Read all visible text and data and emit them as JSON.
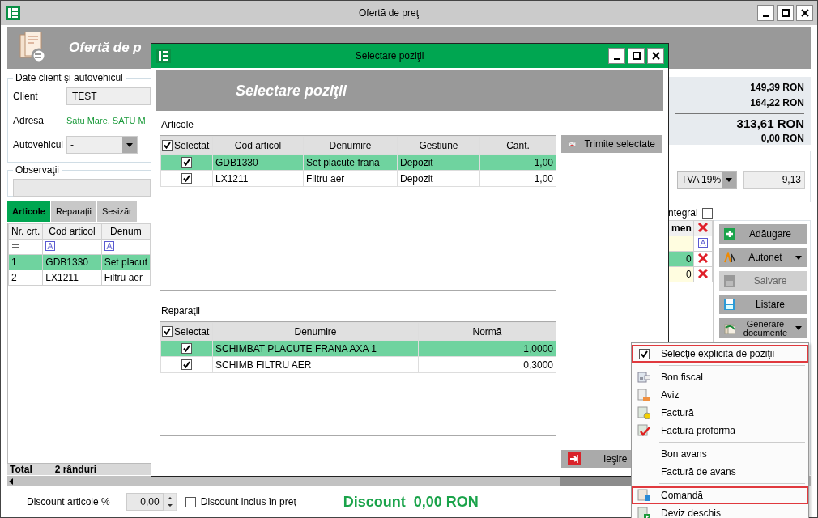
{
  "window": {
    "title": "Ofertă de preţ"
  },
  "header": {
    "title": "Ofertă de p"
  },
  "client_group": {
    "title": "Date client şi autovehicul",
    "fields": [
      {
        "label": "Client",
        "value": "TEST",
        "kind": "text"
      },
      {
        "label": "Adresă",
        "value": "Satu Mare, SATU M",
        "kind": "link"
      },
      {
        "label": "Autovehicul",
        "value": "-",
        "kind": "combo"
      }
    ]
  },
  "observations": {
    "title": "Observaţii"
  },
  "tabs": [
    {
      "label": "Articole",
      "selected": true
    },
    {
      "label": "Reparaţii",
      "selected": false
    },
    {
      "label": "Sesizăr",
      "selected": false
    }
  ],
  "grid": {
    "columns": [
      "Nr. crt.",
      "Cod articol",
      "Denum"
    ],
    "rows": [
      {
        "cells": [
          "1",
          "GDB1330",
          "Set placut"
        ],
        "value": "0",
        "selected": true
      },
      {
        "cells": [
          "2",
          "LX1211",
          "Filtru aer"
        ],
        "value": "0",
        "selected": false
      }
    ],
    "right_column": "men",
    "total_label": "Total",
    "total_count": "2 rânduri"
  },
  "totals": [
    "149,39 RON",
    "164,22 RON",
    "313,61 RON",
    "0,00 RON"
  ],
  "tva": {
    "value": "TVA 19%",
    "amount": "9,13"
  },
  "integral": {
    "label": "ntegral",
    "checked": false
  },
  "actions": [
    {
      "label": "Adăugare",
      "disabled": false,
      "dropdown": false
    },
    {
      "label": "Autonet",
      "disabled": false,
      "dropdown": true
    },
    {
      "label": "Salvare",
      "disabled": true,
      "dropdown": false
    },
    {
      "label": "Listare",
      "disabled": false,
      "dropdown": false
    },
    {
      "label": "Generare documente",
      "disabled": false,
      "dropdown": true
    }
  ],
  "discount": {
    "label": "Discount articole %",
    "value": "0,00",
    "included_label": "Discount inclus în preţ",
    "included": false,
    "summary_label": "Discount",
    "summary_value": "0,00 RON"
  },
  "dialog": {
    "title": "Selectare poziţii",
    "header": "Selectare poziţii",
    "articles": {
      "label": "Articole",
      "all_checked": true,
      "columns": [
        "Selectat",
        "Cod articol",
        "Denumire",
        "Gestiune",
        "Cant."
      ],
      "rows": [
        {
          "checked": true,
          "selected": true,
          "cells": [
            "",
            "GDB1330",
            "Set placute frana",
            "Depozit",
            "1,00"
          ]
        },
        {
          "checked": true,
          "selected": false,
          "cells": [
            "",
            "LX1211",
            "Filtru aer",
            "Depozit",
            "1,00"
          ]
        }
      ]
    },
    "send_button": "Trimite selectate",
    "repairs": {
      "label": "Reparaţii",
      "all_checked": true,
      "columns": [
        "Selectat",
        "Denumire",
        "Normă"
      ],
      "rows": [
        {
          "checked": true,
          "selected": true,
          "cells": [
            "",
            "SCHIMBAT PLACUTE FRANA AXA 1",
            "1,0000"
          ]
        },
        {
          "checked": true,
          "selected": false,
          "cells": [
            "",
            "SCHIMB FILTRU AER",
            "0,3000"
          ]
        }
      ]
    },
    "exit_button": "Ieşire"
  },
  "menu": [
    {
      "label": "Selecţie explicită de poziţii",
      "kind": "check",
      "checked": true,
      "highlighted": true
    },
    {
      "kind": "separator"
    },
    {
      "label": "Bon fiscal",
      "kind": "icon",
      "highlighted": false
    },
    {
      "label": "Aviz",
      "kind": "icon",
      "highlighted": false
    },
    {
      "label": "Factură",
      "kind": "icon",
      "highlighted": false
    },
    {
      "label": "Factură proformă",
      "kind": "icon",
      "highlighted": false
    },
    {
      "kind": "separator"
    },
    {
      "label": "Bon avans",
      "kind": "plain",
      "highlighted": false
    },
    {
      "label": "Factură de avans",
      "kind": "plain",
      "highlighted": false
    },
    {
      "kind": "separator"
    },
    {
      "label": "Comandă",
      "kind": "icon",
      "highlighted": true
    },
    {
      "label": "Deviz deschis",
      "kind": "icon",
      "highlighted": false
    }
  ]
}
